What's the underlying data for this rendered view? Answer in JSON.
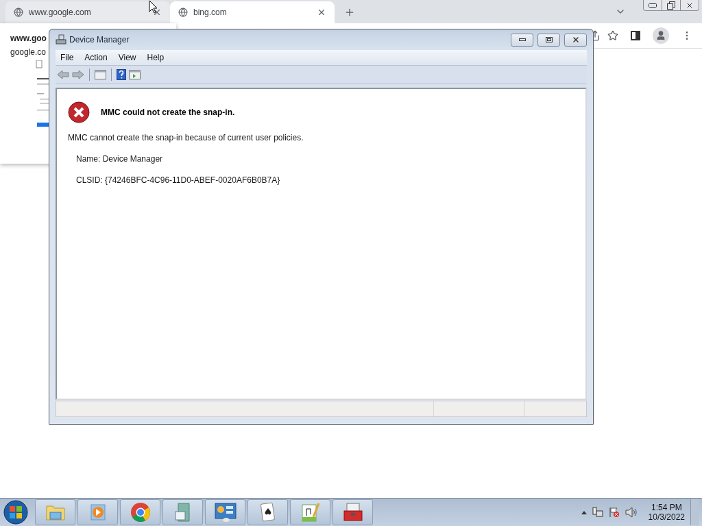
{
  "browser": {
    "tabs": [
      {
        "title": "www.google.com",
        "selected": false
      },
      {
        "title": "bing.com",
        "selected": true
      }
    ],
    "popup": {
      "lines": [
        "www.goo",
        "google.co"
      ]
    }
  },
  "device_manager": {
    "title": "Device Manager",
    "menu": [
      "File",
      "Action",
      "View",
      "Help"
    ],
    "error": {
      "heading": "MMC could not create the snap-in.",
      "message": "MMC cannot create the snap-in because of current user policies.",
      "details": [
        "Name: Device Manager",
        "CLSID: {74246BFC-4C96-11D0-ABEF-0020AF6B0B7A}"
      ]
    }
  },
  "taskbar": {
    "time": "1:54 PM",
    "date": "10/3/2022"
  }
}
